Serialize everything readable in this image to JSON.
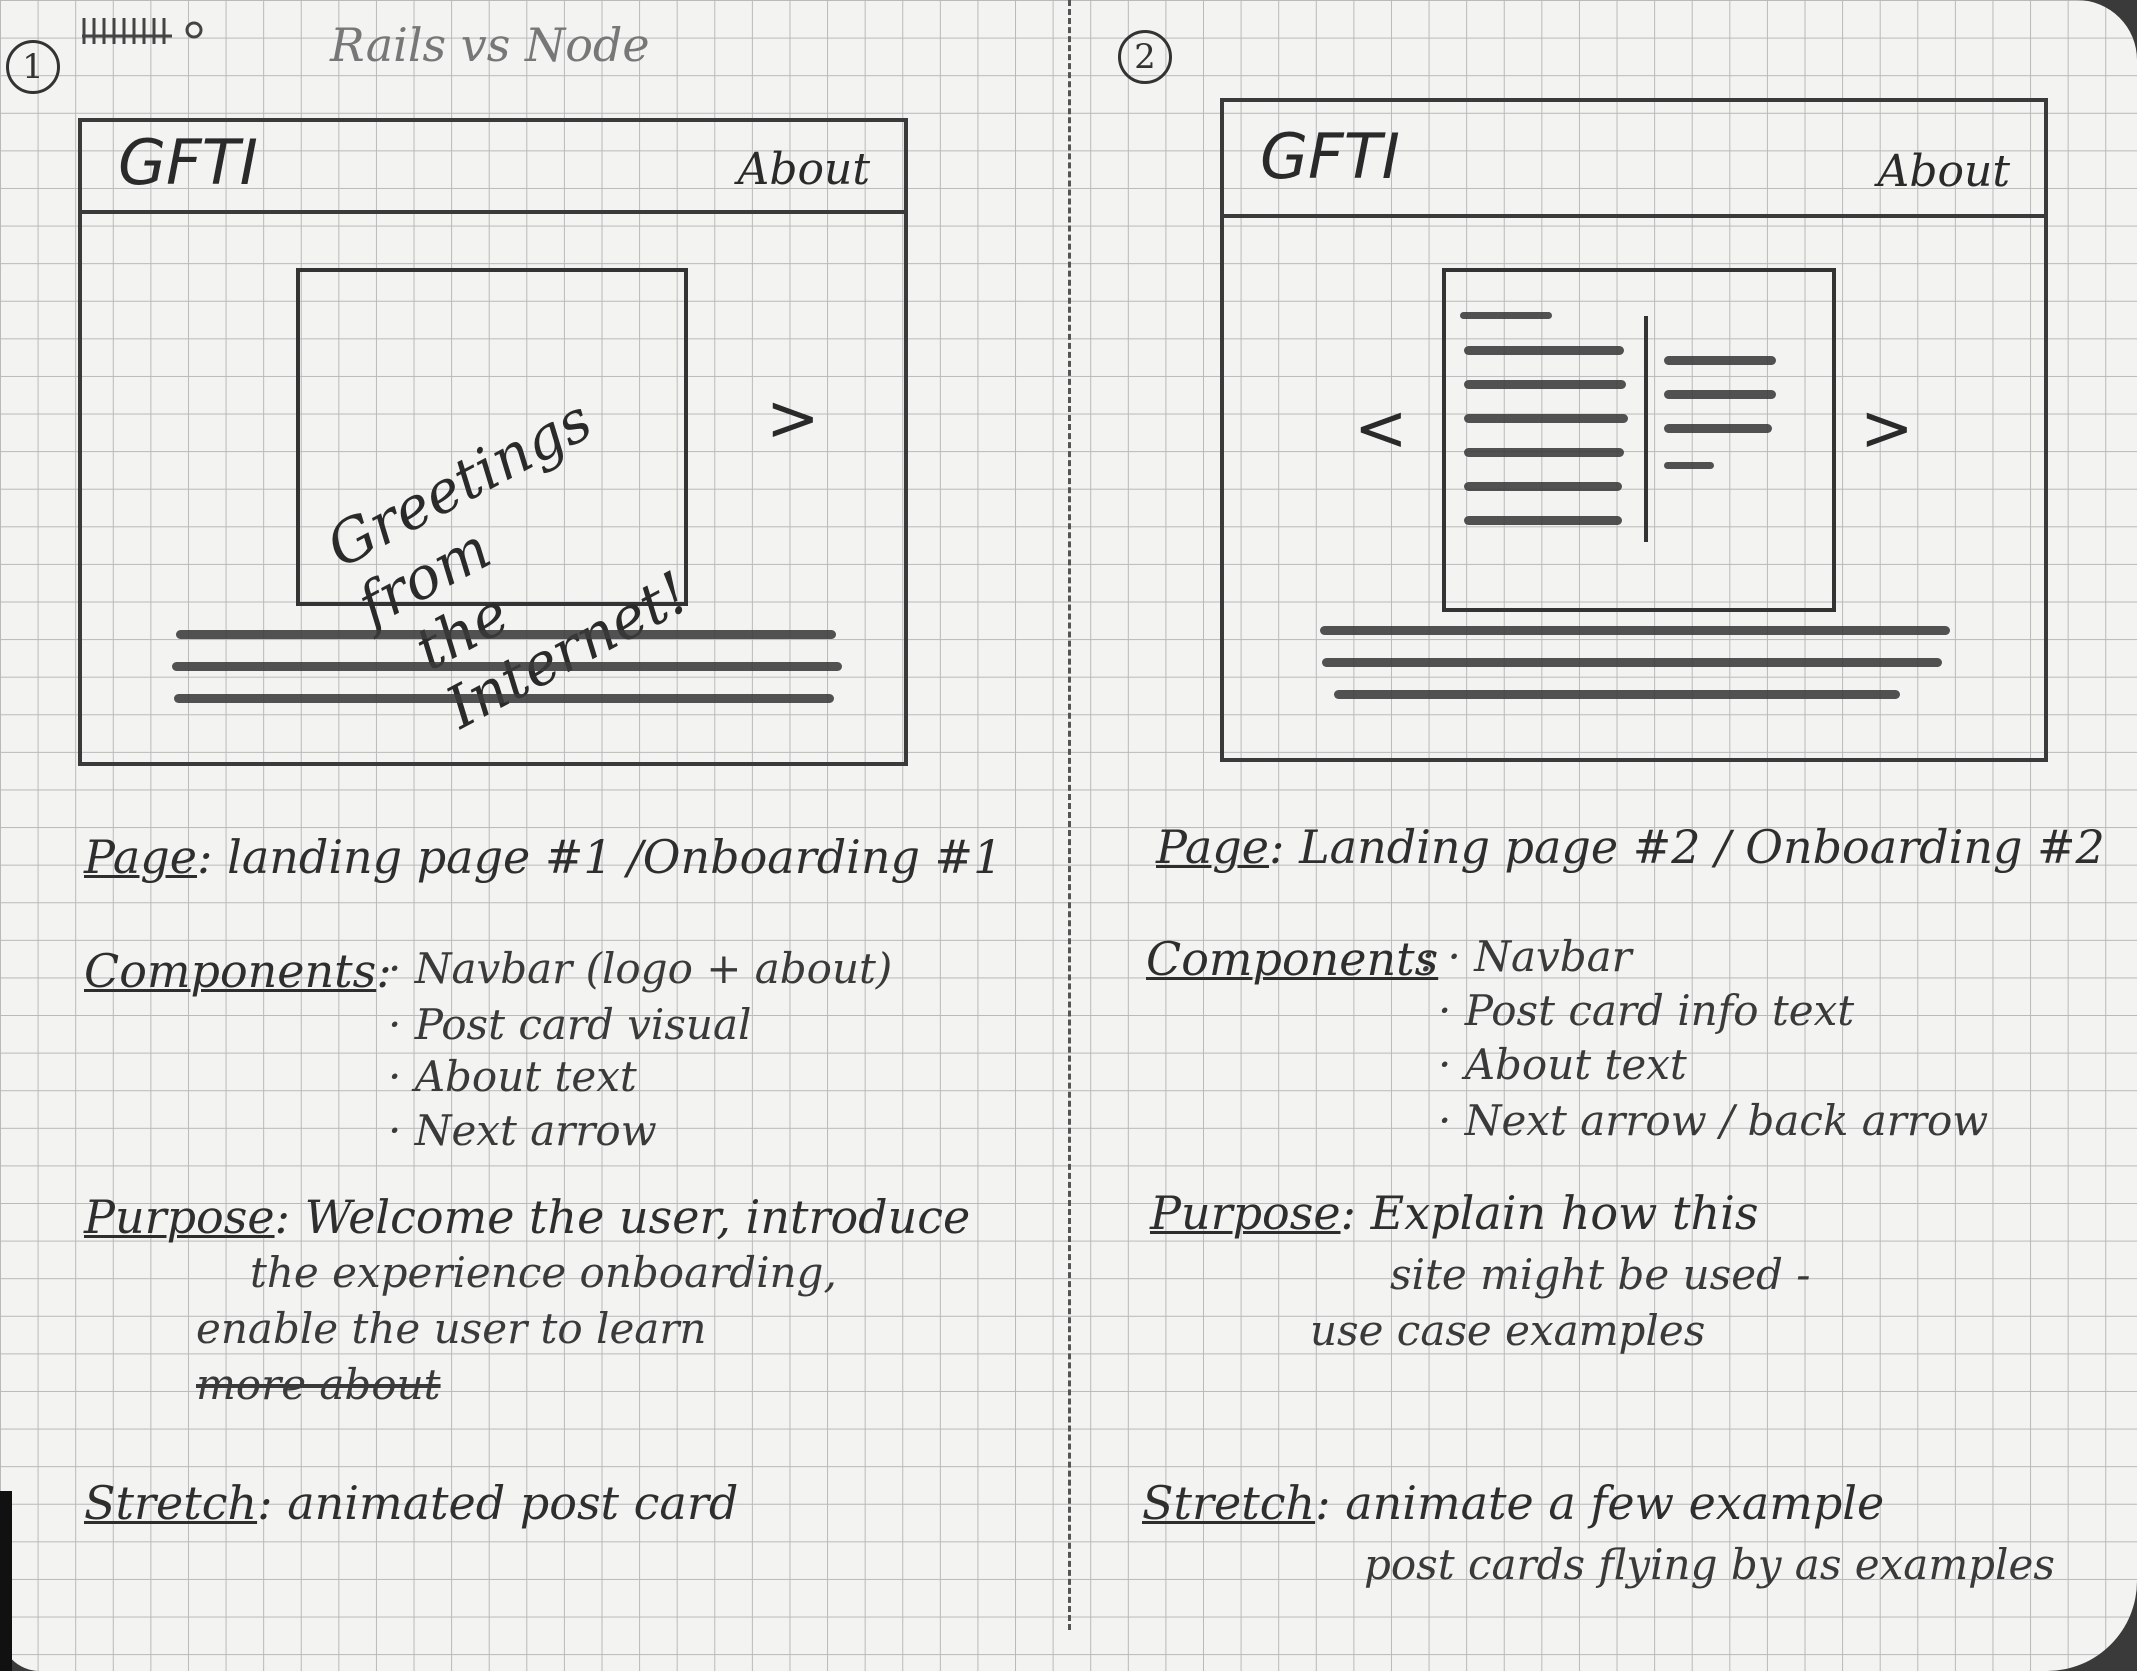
{
  "notebook": {
    "header_note": "Rails vs Node",
    "spread": [
      {
        "number": "1",
        "mockup": {
          "logo": "GFTI",
          "nav_link": "About",
          "postcard_lines": [
            "Greetings from",
            "the Internet!"
          ],
          "next_arrow": ">"
        },
        "page_label": "Page",
        "page_value": ": landing page #1 /Onboarding #1",
        "components_label": "Components",
        "components": [
          "· Navbar (logo + about)",
          "· Post card visual",
          "· About text",
          "· Next arrow"
        ],
        "purpose_label": "Purpose",
        "purpose_lines": [
          ": Welcome the user, introduce",
          "the experience onboarding,",
          "enable the user to learn",
          "more about"
        ],
        "stretch_label": "Stretch",
        "stretch_lines": [
          ": animated post card"
        ]
      },
      {
        "number": "2",
        "mockup": {
          "logo": "GFTI",
          "nav_link": "About",
          "back_arrow": "<",
          "next_arrow": ">"
        },
        "page_label": "Page",
        "page_value": ": Landing page #2 / Onboarding #2",
        "components_label": "Components",
        "components": [
          ": · Navbar",
          "· Post card info text",
          "· About text",
          "· Next arrow / back arrow"
        ],
        "purpose_label": "Purpose",
        "purpose_lines": [
          ": Explain how this",
          "site might be used -",
          "use case examples"
        ],
        "stretch_label": "Stretch",
        "stretch_lines": [
          ": animate a few example",
          "post cards flying by as examples"
        ]
      }
    ]
  }
}
